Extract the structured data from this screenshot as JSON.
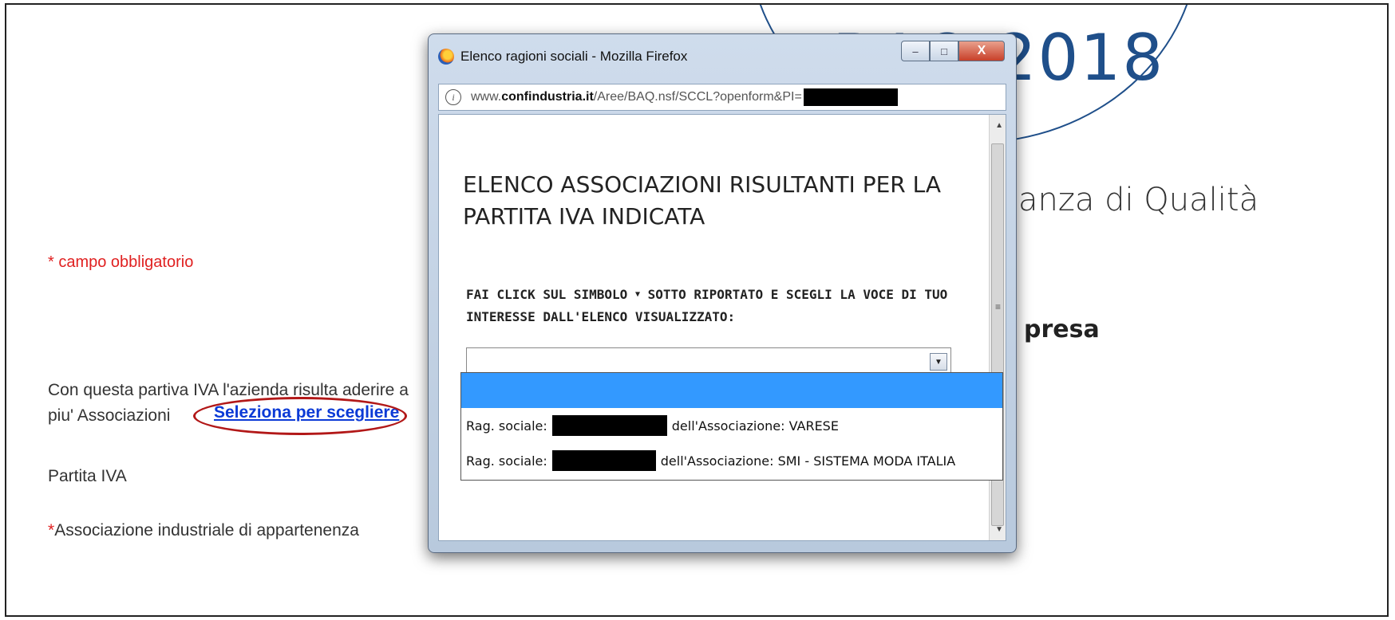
{
  "page": {
    "logo_text": "BAQ 2018",
    "heading": "anza di Qualità",
    "subheading": "presa",
    "required_note": "* campo obbligatorio",
    "membership_text": "Con questa partiva IVA l'azienda risulta aderire a piu' Associazioni",
    "select_link": "Seleziona per scegliere",
    "vat_label": "Partita IVA",
    "assoc_star": "*",
    "assoc_label": "Associazione industriale di appartenenza"
  },
  "popup": {
    "title": "Elenco ragioni sociali - Mozilla Firefox",
    "controls": {
      "minimize": "–",
      "maximize": "□",
      "close": "X"
    },
    "url_prefix": "www.",
    "url_domain": "confindustria.it",
    "url_path": "/Aree/BAQ.nsf/SCCL?openform&PI=",
    "heading": "ELENCO ASSOCIAZIONI RISULTANTI PER LA PARTITA IVA INDICATA",
    "instruction_part1": "FAI CLICK SUL SIMBOLO",
    "instruction_symbol": "▼",
    "instruction_part2": "SOTTO RIPORTATO E SCEGLI LA VOCE DI TUO INTERESSE DALL'ELENCO VISUALIZZATO:",
    "dropdown_value": "",
    "options": [
      {
        "prefix": "",
        "suffix": ""
      },
      {
        "prefix": "Rag. sociale:",
        "suffix": "dell'Associazione: VARESE"
      },
      {
        "prefix": "Rag. sociale:",
        "suffix": "dell'Associazione: SMI - SISTEMA MODA ITALIA"
      }
    ]
  },
  "colors": {
    "accent_link": "#0b3ad6",
    "required_red": "#e02020",
    "highlight_oval": "#b21818",
    "selected_option": "#3399ff"
  }
}
